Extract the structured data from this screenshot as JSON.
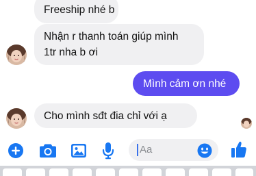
{
  "messages": [
    {
      "direction": "incoming",
      "lines": [
        "Freeship nhé b"
      ]
    },
    {
      "direction": "incoming",
      "lines": [
        "Nhận r thanh toán giúp mình",
        "1tr nha b ơi"
      ]
    },
    {
      "direction": "outgoing",
      "lines": [
        "Mình cảm ơn nhé"
      ]
    },
    {
      "direction": "incoming",
      "lines": [
        "Cho mình sđt đia chỉ với ạ"
      ]
    }
  ],
  "composer": {
    "placeholder": "Aa",
    "icons": [
      "plus-icon",
      "camera-icon",
      "image-icon",
      "microphone-icon",
      "emoji-icon",
      "thumbs-up-icon"
    ],
    "accent_color": "#1877f2"
  },
  "colors": {
    "outgoing_bubble": "#5d4cf0",
    "incoming_bubble": "#f0f0f2"
  }
}
